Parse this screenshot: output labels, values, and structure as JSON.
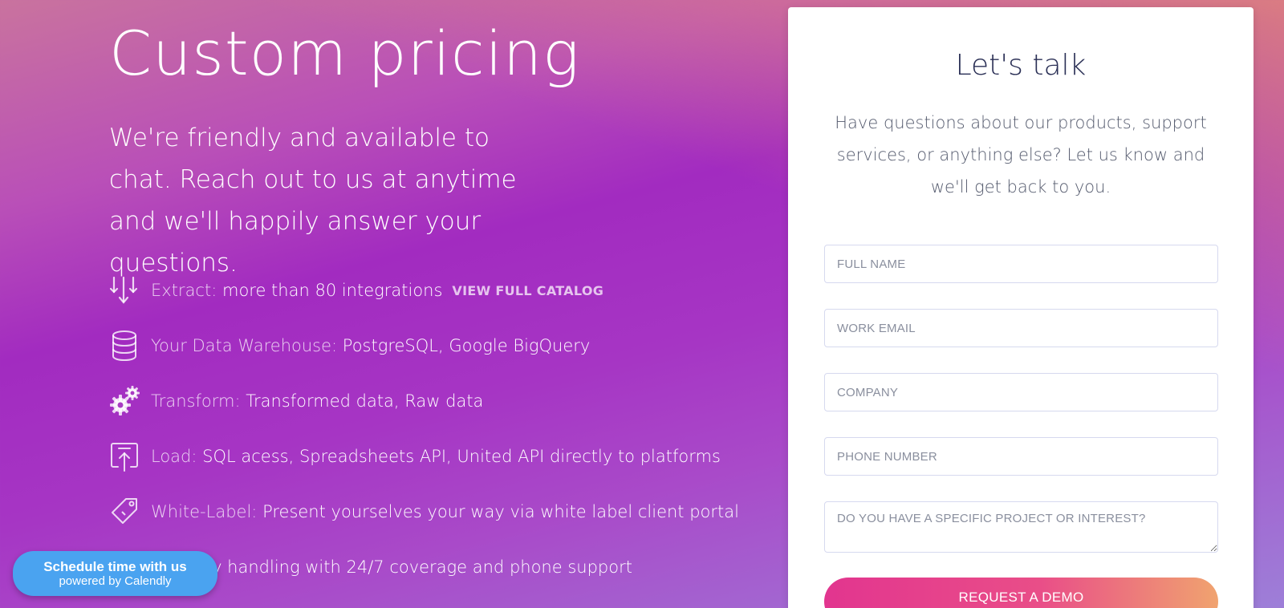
{
  "hero": {
    "title": "Custom pricing",
    "subtitle": "We're friendly and available to chat. Reach out to us at anytime and we'll happily answer your questions."
  },
  "features": [
    {
      "icon": "extract-arrows-icon",
      "key": "Extract:",
      "value": "more than 80 integrations",
      "link": "VIEW FULL CATALOG"
    },
    {
      "icon": "database-icon",
      "key": "Your Data Warehouse:",
      "value": "PostgreSQL, Google BigQuery"
    },
    {
      "icon": "gears-icon",
      "key": "Transform:",
      "value": "Transformed data, Raw data"
    },
    {
      "icon": "upload-load-icon",
      "key": "Load:",
      "value": "SQL acess, Spreadsheets API, United API directly to platforms"
    },
    {
      "icon": "tag-icon",
      "key": "White-Label:",
      "value": "Present yourselves your way via white label client portal"
    },
    {
      "icon": "support-icon",
      "key": ":",
      "value": "Priority handling with 24/7 coverage and phone support"
    }
  ],
  "calendly": {
    "main": "Schedule time with us",
    "sub": "powered by Calendly"
  },
  "form": {
    "title": "Let's talk",
    "description": "Have questions about our products, support services, or anything else? Let us know and we'll get back to you.",
    "fields": {
      "full_name": "FULL NAME",
      "work_email": "WORK EMAIL",
      "company": "COMPANY",
      "phone": "PHONE NUMBER",
      "interest": "DO YOU HAVE A SPECIFIC PROJECT OR INTEREST?"
    },
    "submit_label": "REQUEST A DEMO"
  },
  "colors": {
    "accent_pink": "#e2358f",
    "accent_orange": "#f0a36f",
    "calendly_blue": "#4aa3f0",
    "title_navy": "#2a2f55"
  }
}
